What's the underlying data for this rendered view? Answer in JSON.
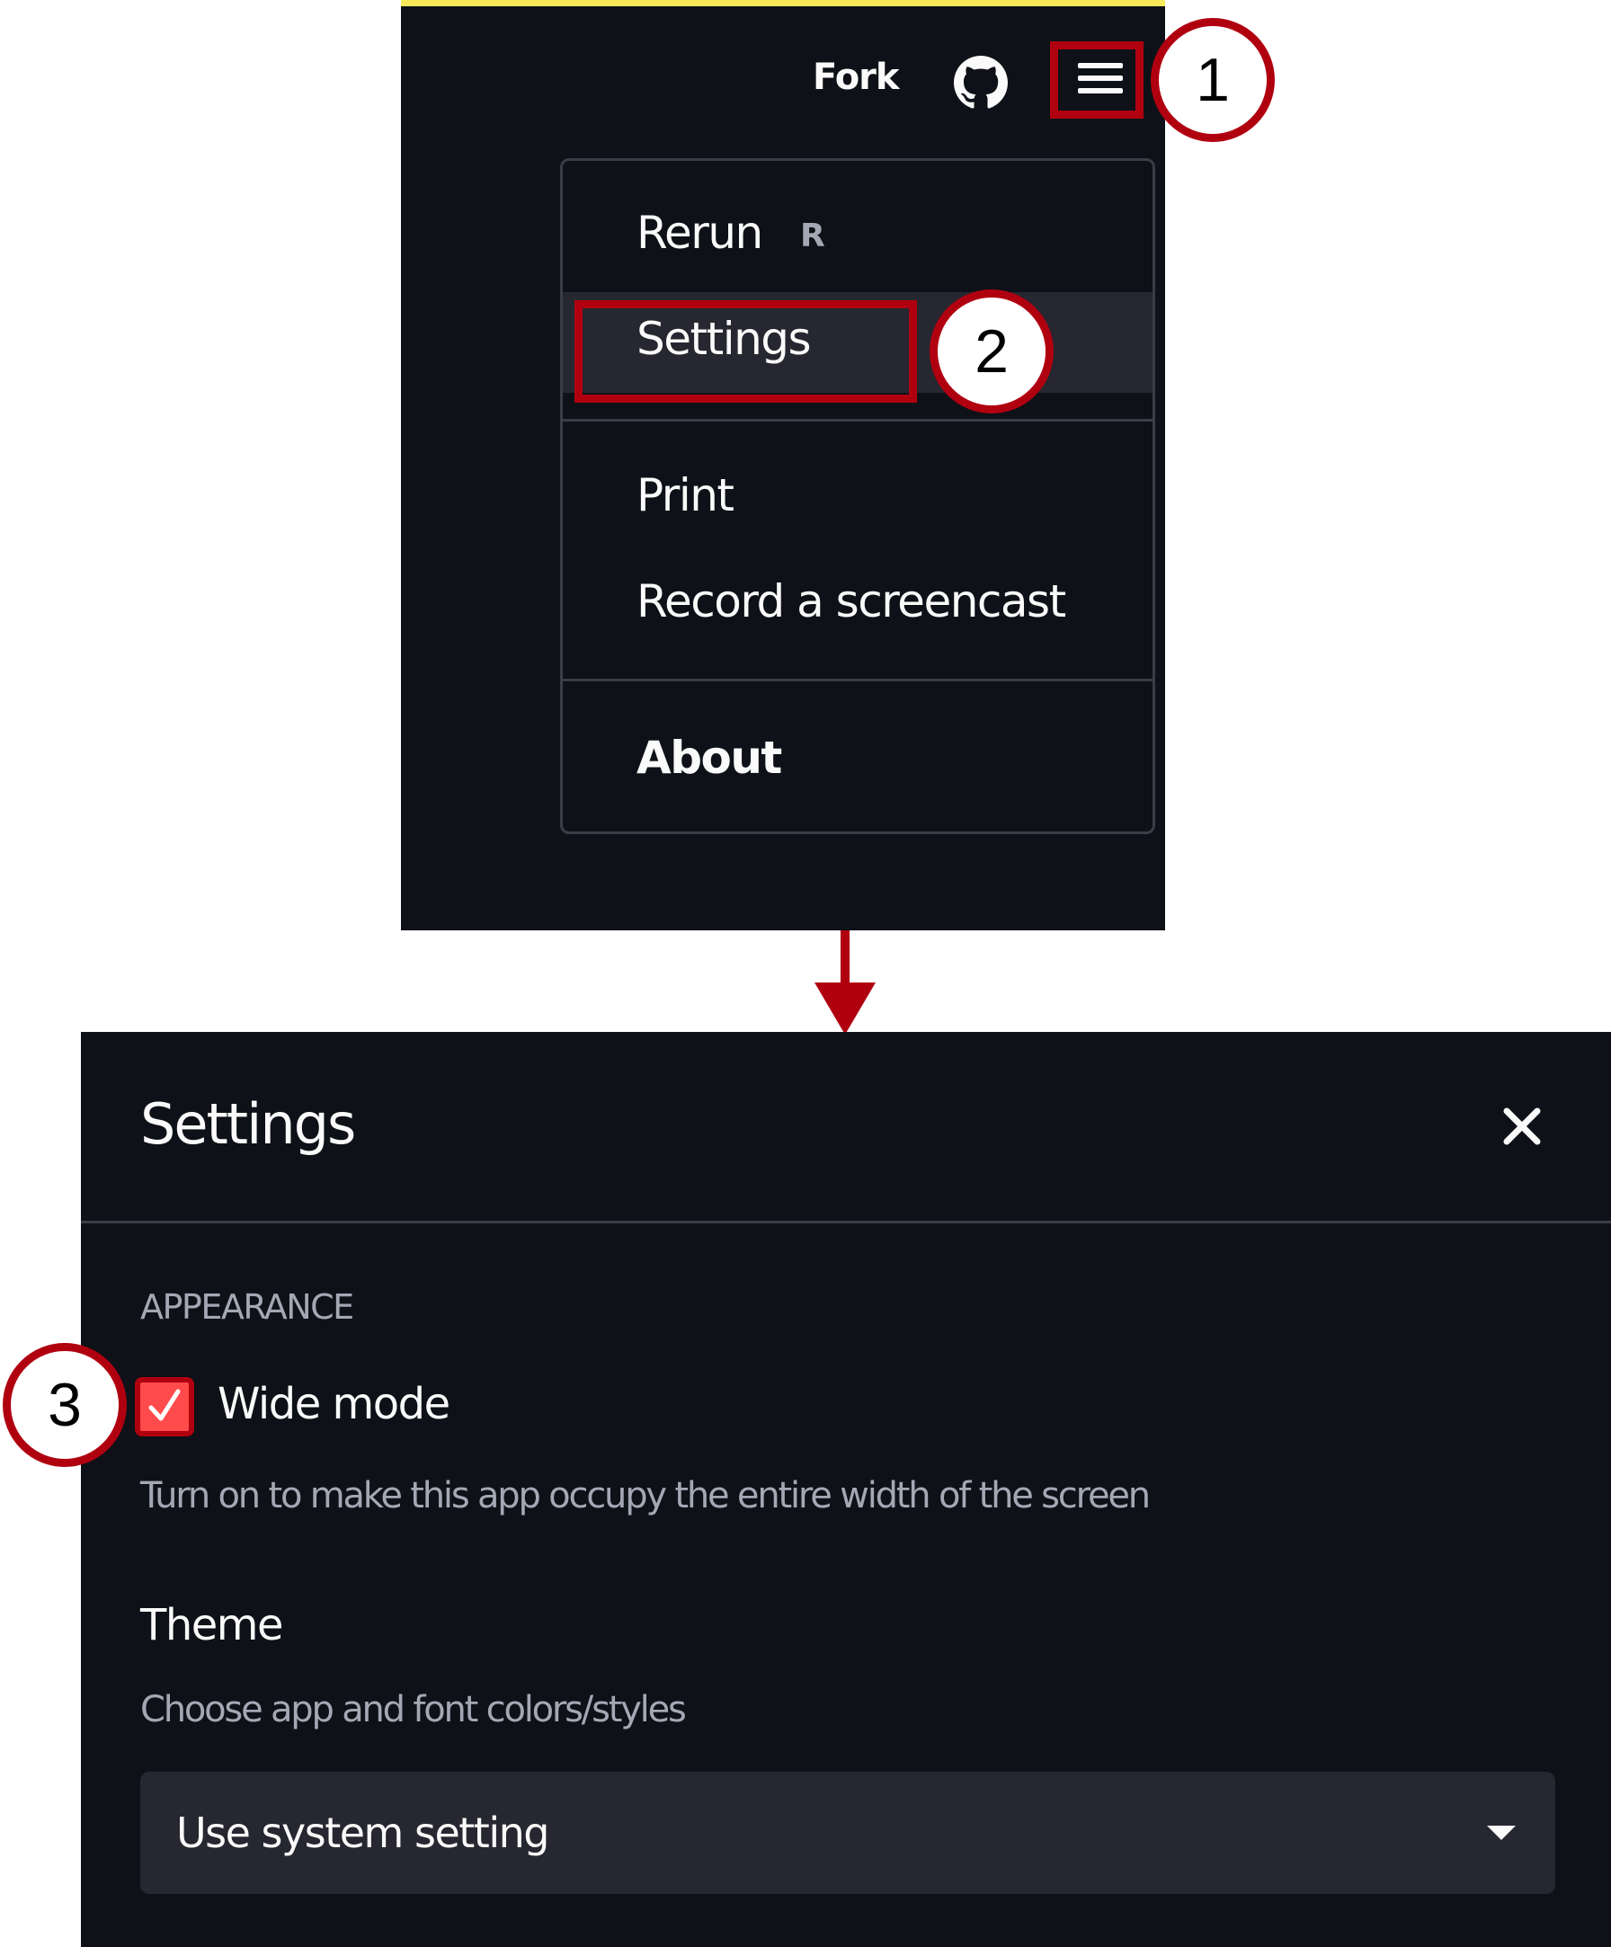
{
  "header": {
    "fork_label": "Fork",
    "github_icon": "github-icon",
    "menu_icon": "hamburger-menu-icon"
  },
  "menu": {
    "items": [
      {
        "label": "Rerun",
        "shortcut": "R"
      },
      {
        "label": "Settings"
      },
      {
        "label": "Print"
      },
      {
        "label": "Record a screencast"
      },
      {
        "label": "About"
      }
    ]
  },
  "settings": {
    "title": "Settings",
    "close_icon": "close-icon",
    "appearance_heading": "APPEARANCE",
    "wide_mode": {
      "label": "Wide mode",
      "checked": true,
      "help": "Turn on to make this app occupy the entire width of the screen"
    },
    "theme": {
      "heading": "Theme",
      "help": "Choose app and font colors/styles",
      "selected": "Use system setting"
    }
  },
  "annotations": {
    "steps": [
      "1",
      "2",
      "3"
    ],
    "highlight_color": "#b00010"
  },
  "colors": {
    "background": "#0e1117",
    "panel": "#262730",
    "accent": "#ff4b4b",
    "top_stripe": "#f9e95a"
  }
}
